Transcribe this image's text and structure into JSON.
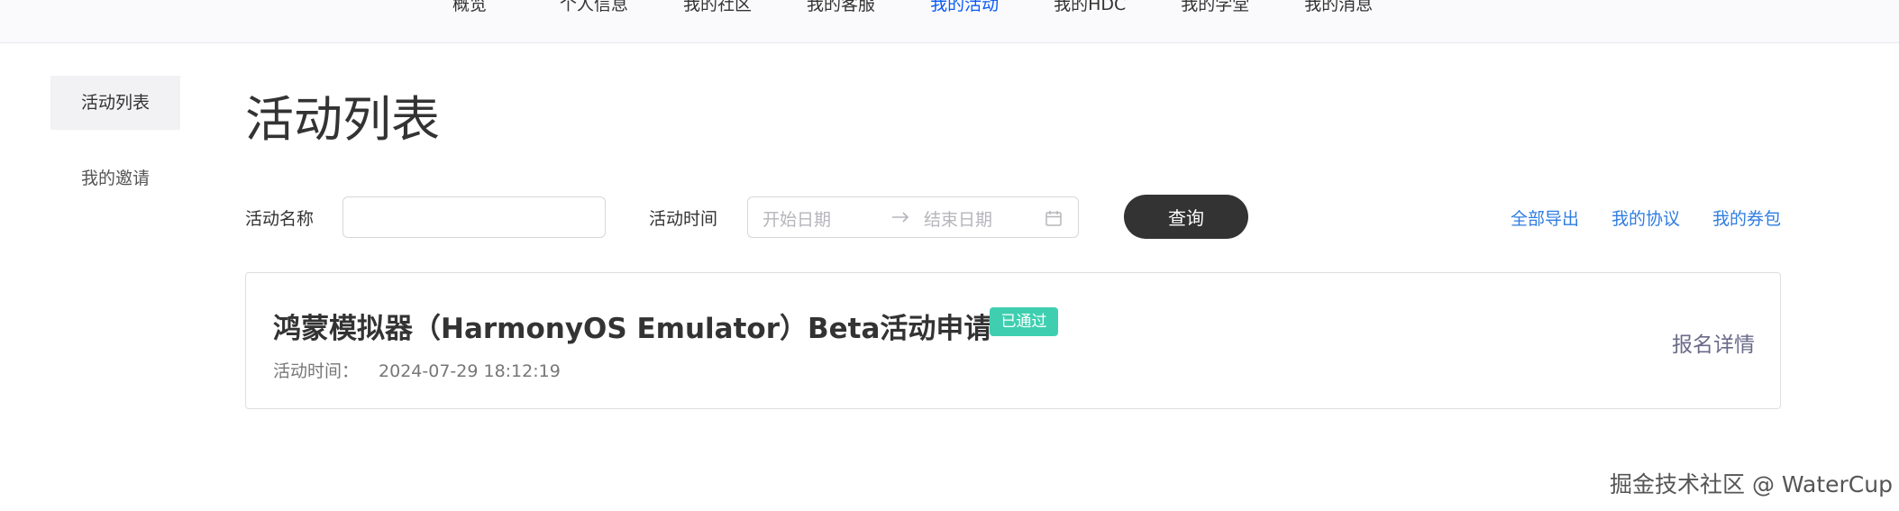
{
  "topnav": {
    "items": [
      {
        "label": "概览",
        "active": false
      },
      {
        "label": "个人信息",
        "active": false
      },
      {
        "label": "我的社区",
        "active": false
      },
      {
        "label": "我的客服",
        "active": false
      },
      {
        "label": "我的活动",
        "active": true
      },
      {
        "label": "我的HDC",
        "active": false
      },
      {
        "label": "我的学堂",
        "active": false
      },
      {
        "label": "我的消息",
        "active": false
      }
    ]
  },
  "sidebar": {
    "items": [
      {
        "label": "活动列表",
        "active": true
      },
      {
        "label": "我的邀请",
        "active": false
      }
    ]
  },
  "page_title": "活动列表",
  "filters": {
    "name_label": "活动名称",
    "name_value": "",
    "time_label": "活动时间",
    "start_placeholder": "开始日期",
    "end_placeholder": "结束日期",
    "query_label": "查询"
  },
  "links": [
    "全部导出",
    "我的协议",
    "我的券包"
  ],
  "activities": [
    {
      "title": "鸿蒙模拟器（HarmonyOS Emulator）Beta活动申请",
      "status": "已通过",
      "time_label": "活动时间：",
      "time_value": "2024-07-29 18:12:19",
      "detail_label": "报名详情"
    }
  ],
  "watermark": "掘金技术社区 @ WaterCup",
  "colors": {
    "accent": "#0a59f7",
    "link": "#2f7de1",
    "status_approved": "#3fcfb0",
    "button_dark": "#333333"
  },
  "icons": {
    "date_arrow": "arrow-right-icon",
    "calendar": "calendar-icon"
  }
}
